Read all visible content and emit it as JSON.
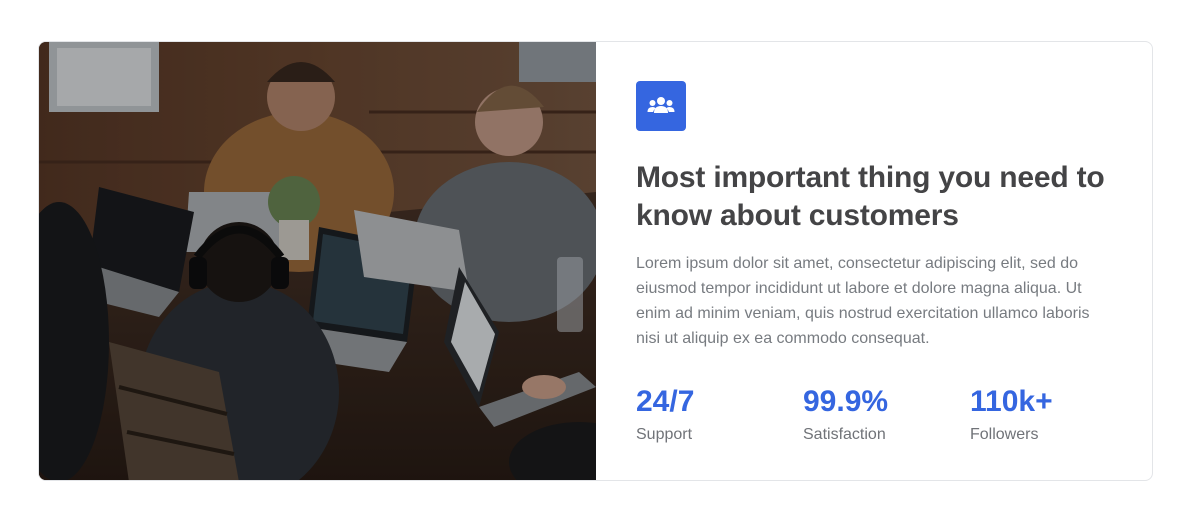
{
  "colors": {
    "accent": "#3566e0",
    "heading": "#444446",
    "body_text": "#777b80"
  },
  "media": {
    "photo_alt": "team-working-on-laptops-photo"
  },
  "feature": {
    "icon": "users-group-icon",
    "title": "Most important thing you need to know about customers",
    "description": "Lorem ipsum dolor sit amet, consectetur adipiscing elit, sed do eiusmod tempor incididunt ut labore et dolore magna aliqua. Ut enim ad minim veniam, quis nostrud exercitation ullamco laboris nisi ut aliquip ex ea commodo consequat."
  },
  "stats": [
    {
      "value": "24/7",
      "label": "Support"
    },
    {
      "value": "99.9%",
      "label": "Satisfaction"
    },
    {
      "value": "110k+",
      "label": "Followers"
    }
  ]
}
